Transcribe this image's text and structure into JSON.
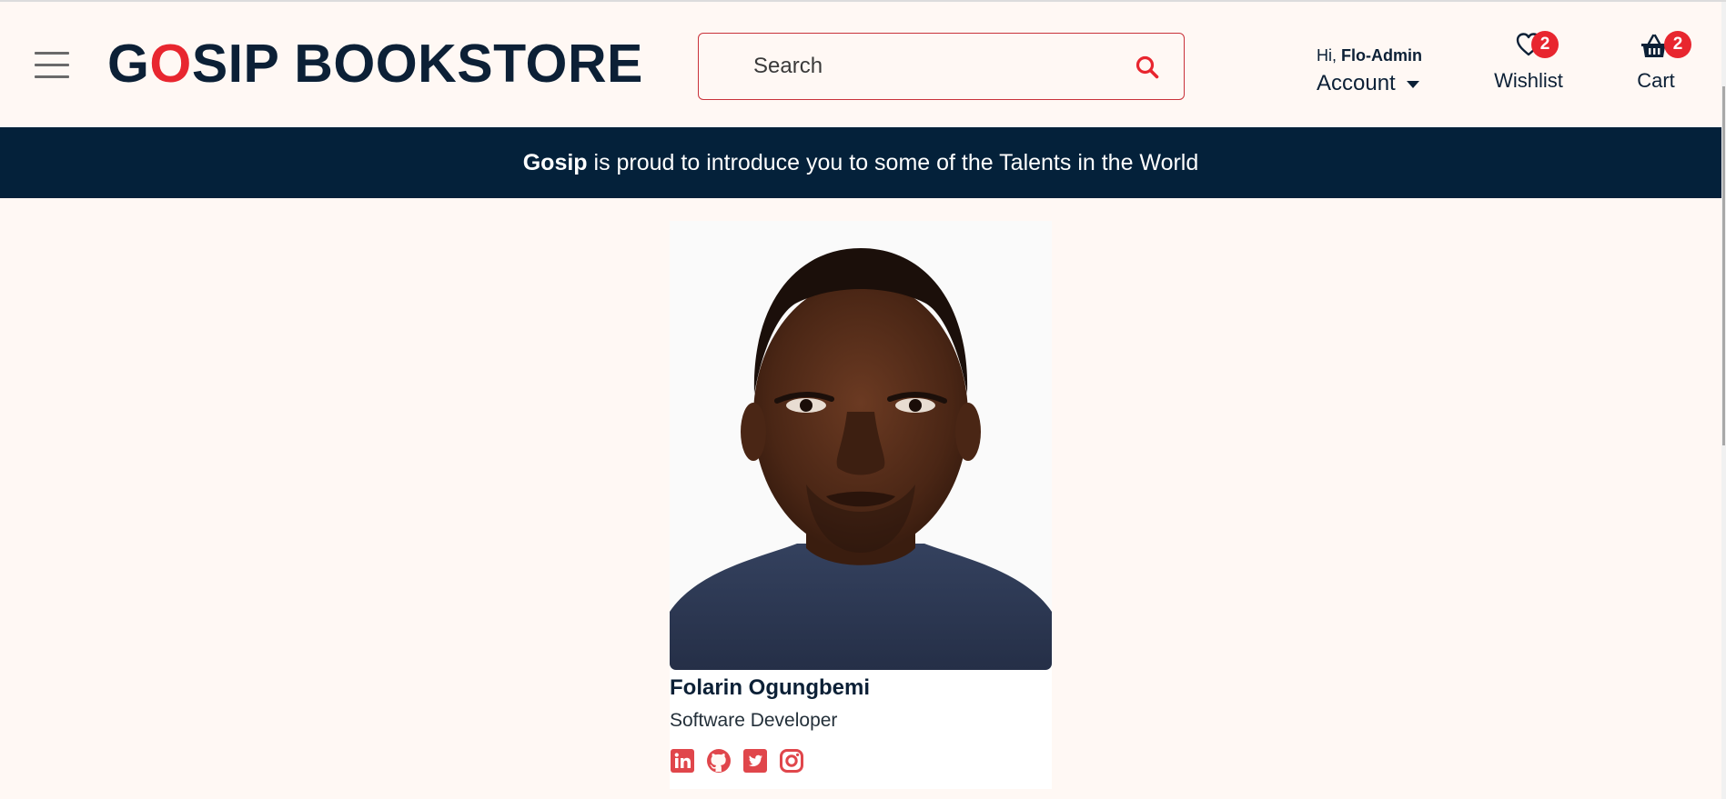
{
  "header": {
    "logo": {
      "letter_g": "G",
      "letter_o": "O",
      "rest": "SIP BOOKSTORE"
    },
    "search": {
      "placeholder": "Search"
    },
    "account": {
      "greeting": "Hi,",
      "username": "Flo-Admin",
      "label": "Account"
    },
    "wishlist": {
      "label": "Wishlist",
      "count": "2"
    },
    "cart": {
      "label": "Cart",
      "count": "2"
    }
  },
  "banner": {
    "brand": "Gosip",
    "text": " is proud to introduce you to some of the Talents in the World"
  },
  "profile": {
    "name": "Folarin Ogungbemi",
    "role": "Software Developer",
    "socials": [
      "linkedin-icon",
      "github-icon",
      "twitter-icon",
      "instagram-icon"
    ]
  },
  "colors": {
    "accent": "#e8262f",
    "navy": "#0c2036",
    "banner": "#04213a",
    "background": "#fff8f4",
    "social": "#e0464b"
  }
}
